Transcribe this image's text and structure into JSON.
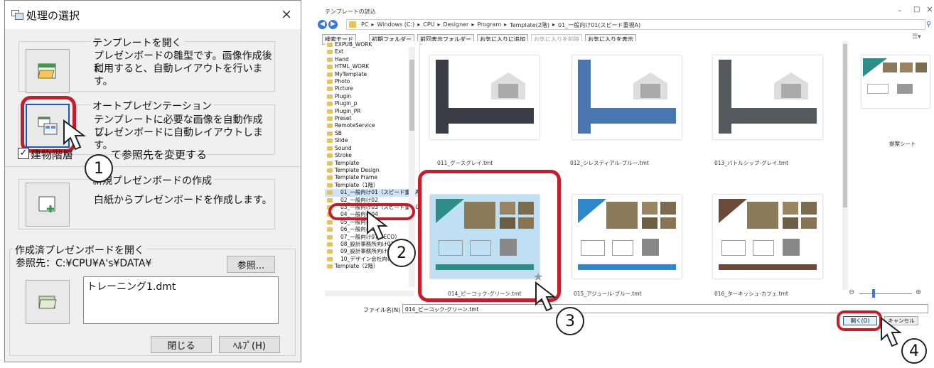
{
  "dialog": {
    "title": "処理の選択",
    "close_glyph": "×",
    "template_section": {
      "title": "テンプレートを開く",
      "desc1": "プレゼンボードの雛型です。画像作成後に",
      "desc2": "利用すると、自動レイアウトを行います。"
    },
    "auto_section": {
      "title": "オートプレゼンテーション",
      "desc1": "テンプレートに必要な画像を自動作成し、",
      "desc2": "プレゼンボードに自動レイアウトします。"
    },
    "checkbox_label_a": "建物階層",
    "checkbox_label_b": "て参照先を変更する",
    "new_section": {
      "title": "新規プレゼンボードの作成",
      "desc": "白紙からプレゼンボードを作成します。"
    },
    "existing_section": {
      "title": "作成済プレゼンボードを開く",
      "ref_label": "参照先：C:¥CPU¥A's¥DATA¥",
      "browse_label": "参照...",
      "file_item": "トレーニング1.dmt"
    },
    "close_button": "閉じる",
    "help_button": "ﾍﾙﾌﾟ(H)"
  },
  "window": {
    "title": "テンプレートの読込",
    "breadcrumb": [
      "PC",
      "Windows (C:)",
      "CPU",
      "Designer",
      "Program",
      "Template(2階)",
      "01_一般向け01(スピード重視A)"
    ],
    "toolbar": [
      "検索モード",
      "初期フォルダー",
      "前回表示フォルダー",
      "お気に入りに追加",
      "お気に入りを削除",
      "お気に入りを表示"
    ],
    "tree_items": [
      "EXPUB_WORK",
      "Ext",
      "Hand",
      "HTML_WORK",
      "MyTemplate",
      "Photo",
      "Picture",
      "Plugin",
      "Plugin_p",
      "Plugin_PR",
      "Preset",
      "RemoteService",
      "SB",
      "Slide",
      "Sound",
      "Stroke",
      "Template",
      "Template Design",
      "Template Frame",
      "Template（1階）",
      "01_一般向け01（スピード重視A）",
      "02_一般向け02",
      "03_一般向け03（スピード重視C）",
      "04_一般向け04",
      "05_一般向け05",
      "06_一般向け06",
      "07_一般向け07（ECO）",
      "08_設計事務所向け01",
      "09_設計事務所向け02",
      "10_デザイン会社向け01",
      "Template（2階）"
    ],
    "thumbnails": [
      {
        "caption": "011_グースグレイ.tmt",
        "color": "#3a3d45"
      },
      {
        "caption": "012_シレスティアル-ブルー.tmt",
        "color": "#4a76b0"
      },
      {
        "caption": "013_バトルシップ-グレイ.tmt",
        "color": "#545a5e"
      },
      {
        "caption": "014_ピーコック-グリーン.tmt",
        "color": "#2e8d86"
      },
      {
        "caption": "015_アジュール-ブルー.tmt",
        "color": "#2f86c8"
      },
      {
        "caption": "016_ターキッシュ-カフェ.tmt",
        "color": "#6b4a3a"
      }
    ],
    "preview_caption": "提案シート",
    "filename_label": "ファイル名(N)",
    "filename_value": "014_ピーコック-グリーン.tmt",
    "open_button": "開く(O)",
    "cancel_button": "キャンセル"
  },
  "callouts": [
    "1",
    "2",
    "3",
    "4"
  ]
}
